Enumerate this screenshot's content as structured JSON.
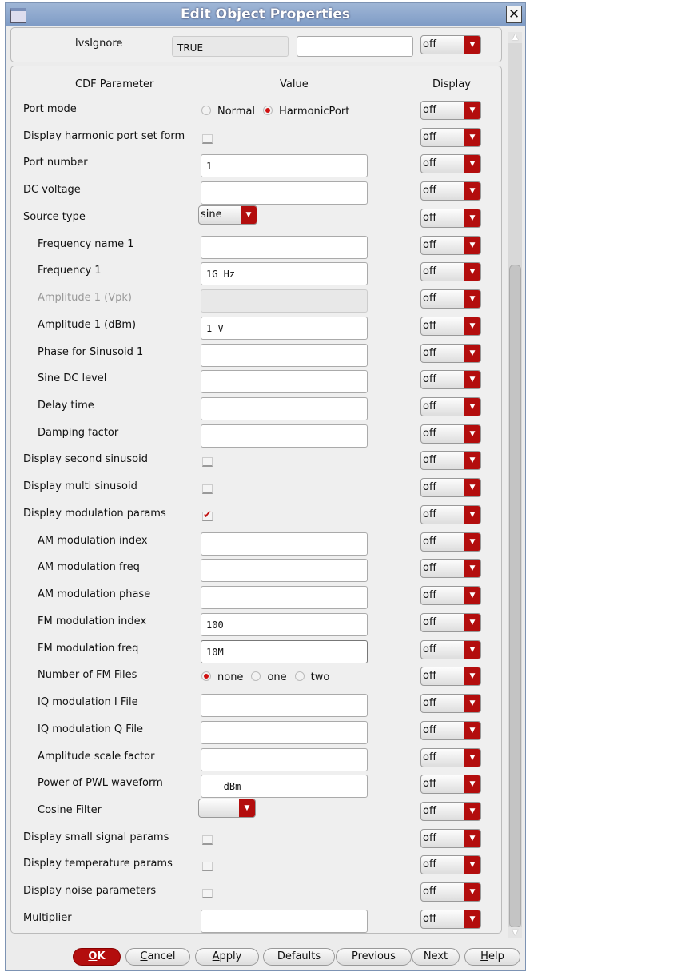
{
  "window": {
    "title": "Edit Object Properties"
  },
  "top": {
    "label": "lvsIgnore",
    "value": "TRUE",
    "extra": "",
    "display": "off"
  },
  "headers": {
    "param": "CDF Parameter",
    "value": "Value",
    "display": "Display"
  },
  "rows": [
    {
      "label": "Port mode",
      "indent": false,
      "type": "radio",
      "options": [
        "Normal",
        "HarmonicPort"
      ],
      "selected": 1,
      "display": "off"
    },
    {
      "label": "Display harmonic port set form",
      "indent": false,
      "type": "checkbox",
      "checked": false,
      "display": "off"
    },
    {
      "label": "Port number",
      "indent": false,
      "type": "text",
      "value": "1",
      "display": "off"
    },
    {
      "label": "DC voltage",
      "indent": false,
      "type": "text",
      "value": "",
      "display": "off"
    },
    {
      "label": "Source type",
      "indent": false,
      "type": "select",
      "value": "sine",
      "display": "off"
    },
    {
      "label": "Frequency name 1",
      "indent": true,
      "type": "text",
      "value": "",
      "display": "off"
    },
    {
      "label": "Frequency 1",
      "indent": true,
      "type": "text",
      "value": "1G Hz",
      "display": "off"
    },
    {
      "label": "Amplitude 1 (Vpk)",
      "indent": true,
      "type": "disabled",
      "value": "",
      "display": "off"
    },
    {
      "label": "Amplitude 1 (dBm)",
      "indent": true,
      "type": "text",
      "value": "1 V",
      "display": "off"
    },
    {
      "label": "Phase for Sinusoid 1",
      "indent": true,
      "type": "text",
      "value": "",
      "display": "off"
    },
    {
      "label": "Sine DC level",
      "indent": true,
      "type": "text",
      "value": "",
      "display": "off"
    },
    {
      "label": "Delay time",
      "indent": true,
      "type": "text",
      "value": "",
      "display": "off"
    },
    {
      "label": "Damping factor",
      "indent": true,
      "type": "text",
      "value": "",
      "display": "off"
    },
    {
      "label": "Display second sinusoid",
      "indent": false,
      "type": "checkbox",
      "checked": false,
      "display": "off"
    },
    {
      "label": "Display multi sinusoid",
      "indent": false,
      "type": "checkbox",
      "checked": false,
      "display": "off"
    },
    {
      "label": "Display modulation params",
      "indent": false,
      "type": "checkbox",
      "checked": true,
      "display": "off"
    },
    {
      "label": "AM modulation index",
      "indent": true,
      "type": "text",
      "value": "",
      "display": "off"
    },
    {
      "label": "AM modulation freq",
      "indent": true,
      "type": "text",
      "value": "",
      "display": "off"
    },
    {
      "label": "AM modulation phase",
      "indent": true,
      "type": "text",
      "value": "",
      "display": "off"
    },
    {
      "label": "FM modulation index",
      "indent": true,
      "type": "text",
      "value": "100",
      "display": "off"
    },
    {
      "label": "FM modulation freq",
      "indent": true,
      "type": "text",
      "value": "10M",
      "focused": true,
      "display": "off"
    },
    {
      "label": "Number of FM Files",
      "indent": true,
      "type": "radio",
      "options": [
        "none",
        "one",
        "two"
      ],
      "selected": 0,
      "display": "off"
    },
    {
      "label": "IQ modulation I File",
      "indent": true,
      "type": "text",
      "value": "",
      "display": "off"
    },
    {
      "label": "IQ modulation Q File",
      "indent": true,
      "type": "text",
      "value": "",
      "display": "off"
    },
    {
      "label": "Amplitude scale factor",
      "indent": true,
      "type": "text",
      "value": "",
      "display": "off"
    },
    {
      "label": "Power of PWL waveform",
      "indent": true,
      "type": "text",
      "value": "   dBm",
      "display": "off"
    },
    {
      "label": "Cosine Filter",
      "indent": true,
      "type": "select",
      "value": "",
      "display": "off"
    },
    {
      "label": "Display small signal params",
      "indent": false,
      "type": "checkbox",
      "checked": false,
      "display": "off"
    },
    {
      "label": "Display temperature params",
      "indent": false,
      "type": "checkbox",
      "checked": false,
      "display": "off"
    },
    {
      "label": "Display noise parameters",
      "indent": false,
      "type": "checkbox",
      "checked": false,
      "display": "off"
    },
    {
      "label": "Multiplier",
      "indent": false,
      "type": "text",
      "value": "",
      "display": "off"
    }
  ],
  "buttons": [
    {
      "key": "ok",
      "mn": "O",
      "rest": "K"
    },
    {
      "key": "cancel",
      "mn": "C",
      "rest": "ancel"
    },
    {
      "key": "apply",
      "mn": "A",
      "rest": "pply"
    },
    {
      "key": "defaults",
      "mn": "",
      "rest": "Defaults"
    },
    {
      "key": "previous",
      "mn": "",
      "rest": "Previous"
    },
    {
      "key": "next",
      "mn": "",
      "rest": "Next"
    },
    {
      "key": "help",
      "mn": "H",
      "rest": "elp"
    }
  ],
  "colors": {
    "accent": "#b30d0d",
    "title_bar": "#8aa6cc"
  }
}
